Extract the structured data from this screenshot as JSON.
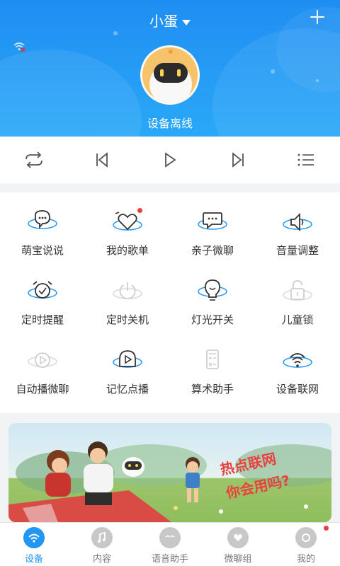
{
  "header": {
    "title": "小蛋",
    "status": "设备离线",
    "accent": "#1f8ef2"
  },
  "player": {
    "buttons": [
      "repeat-icon",
      "previous-icon",
      "play-icon",
      "next-icon",
      "playlist-icon"
    ]
  },
  "functions": [
    {
      "label": "萌宝说说",
      "icon": "chat-bubble-icon",
      "badge": false
    },
    {
      "label": "我的歌单",
      "icon": "heart-playlist-icon",
      "badge": true
    },
    {
      "label": "亲子微聊",
      "icon": "message-icon",
      "badge": false
    },
    {
      "label": "音量调整",
      "icon": "volume-icon",
      "badge": false
    },
    {
      "label": "定时提醒",
      "icon": "alarm-icon",
      "badge": false
    },
    {
      "label": "定时关机",
      "icon": "power-icon",
      "badge": false
    },
    {
      "label": "灯光开关",
      "icon": "light-bulb-icon",
      "badge": false
    },
    {
      "label": "儿童锁",
      "icon": "lock-icon",
      "badge": false
    },
    {
      "label": "自动播微聊",
      "icon": "autoplay-icon",
      "badge": false
    },
    {
      "label": "记忆点播",
      "icon": "memory-play-icon",
      "badge": false
    },
    {
      "label": "算术助手",
      "icon": "calculator-icon",
      "badge": false
    },
    {
      "label": "设备联网",
      "icon": "wifi-icon",
      "badge": false
    }
  ],
  "banner": {
    "line1": "热点联网",
    "line2": "你会用吗?"
  },
  "tabs": [
    {
      "label": "设备",
      "active": true
    },
    {
      "label": "内容",
      "active": false
    },
    {
      "label": "语音助手",
      "active": false
    },
    {
      "label": "微聊组",
      "active": false
    },
    {
      "label": "我的",
      "active": false
    }
  ]
}
